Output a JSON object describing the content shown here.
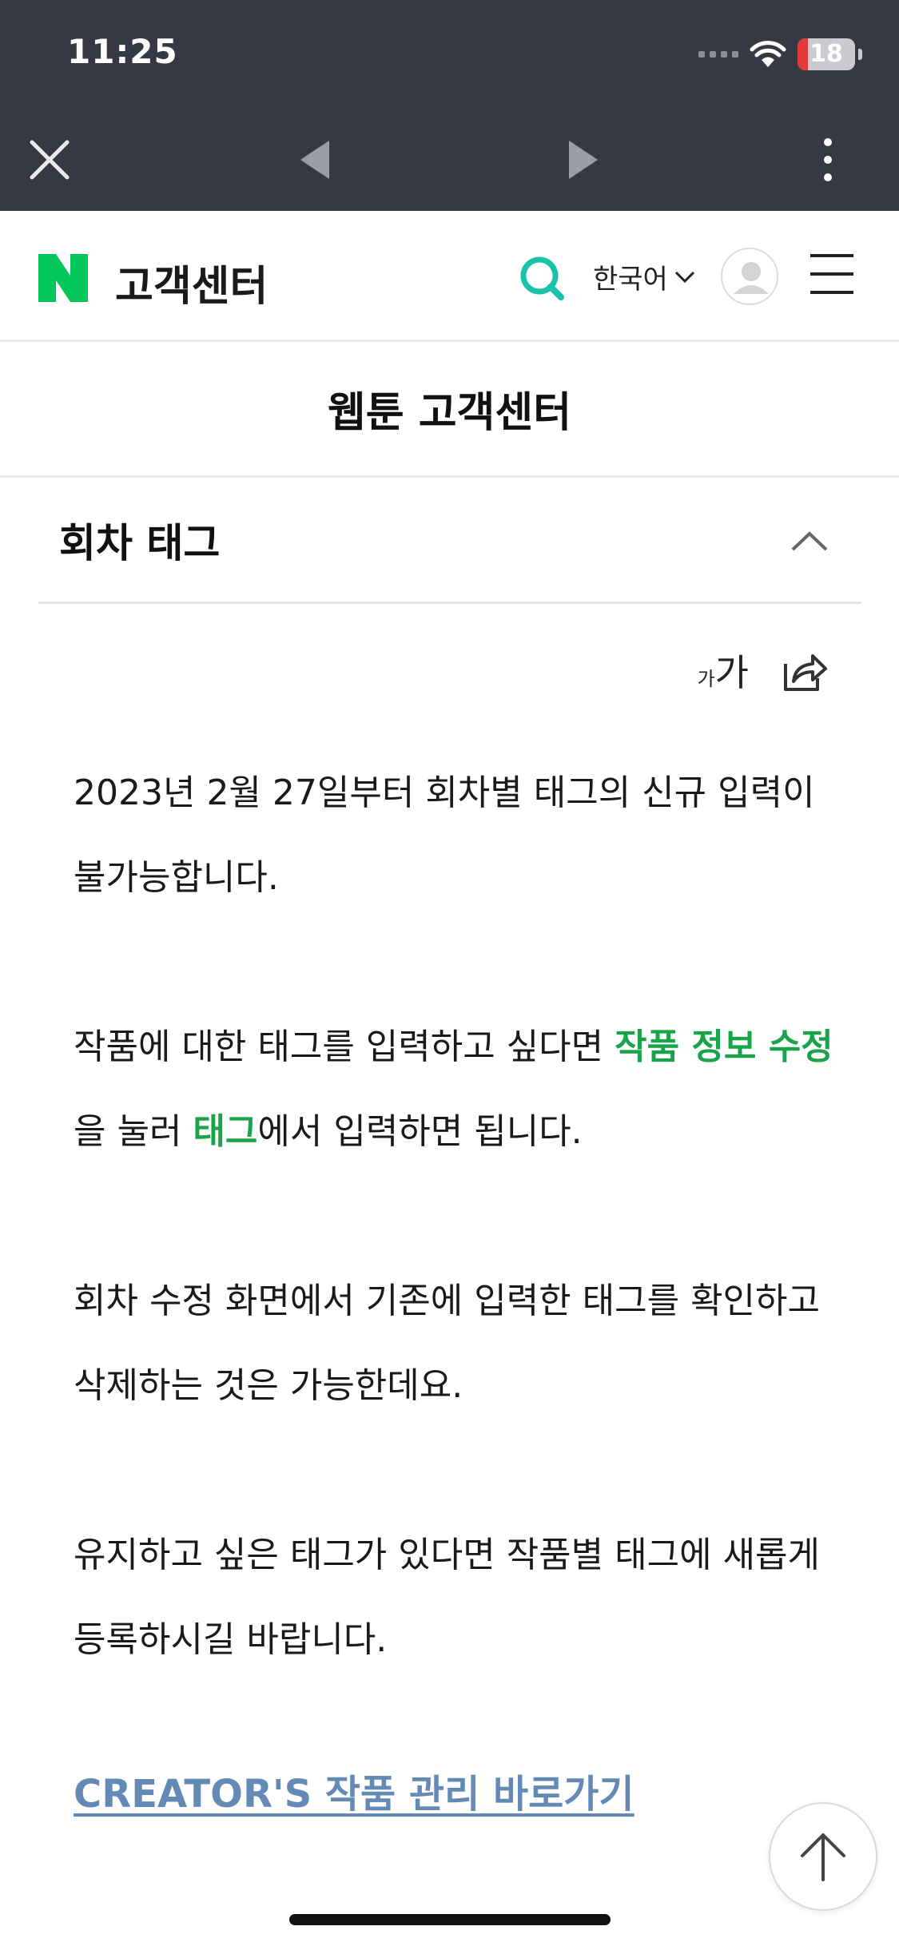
{
  "status_bar": {
    "time": "11:25",
    "battery": "18",
    "battery_level_percent": 18
  },
  "browser": {
    "close_icon": "close-icon",
    "back_icon": "triangle-left-icon",
    "forward_icon": "triangle-right-icon",
    "more_icon": "vertical-dots-icon"
  },
  "header": {
    "logo_letter": "N",
    "title": "고객센터",
    "language": "한국어",
    "brand_color": "#03c75a",
    "search_color": "#19c2a8"
  },
  "section": {
    "title": "웹툰 고객센터"
  },
  "article": {
    "title": "회차 태그",
    "font_small": "가",
    "font_big": "가",
    "paragraphs": {
      "p1": "2023년 2월 27일부터 회차별 태그의 신규 입력이 불가능합니다.",
      "p2_a": "작품에 대한 태그를 입력하고 싶다면 ",
      "p2_b": "작품 정보 수정",
      "p2_c": "을 눌러 ",
      "p2_d": "태그",
      "p2_e": "에서 입력하면 됩니다.",
      "p3": "회차 수정 화면에서 기존에 입력한 태그를 확인하고 삭제하는 것은 가능한데요.",
      "p4": "유지하고 싶은 태그가 있다면 작품별 태그에 새롭게 등록하시길 바랍니다."
    },
    "link": "CREATOR'S 작품 관리 바로가기",
    "highlight_color": "#1aa34a",
    "link_color": "#6389b5"
  }
}
